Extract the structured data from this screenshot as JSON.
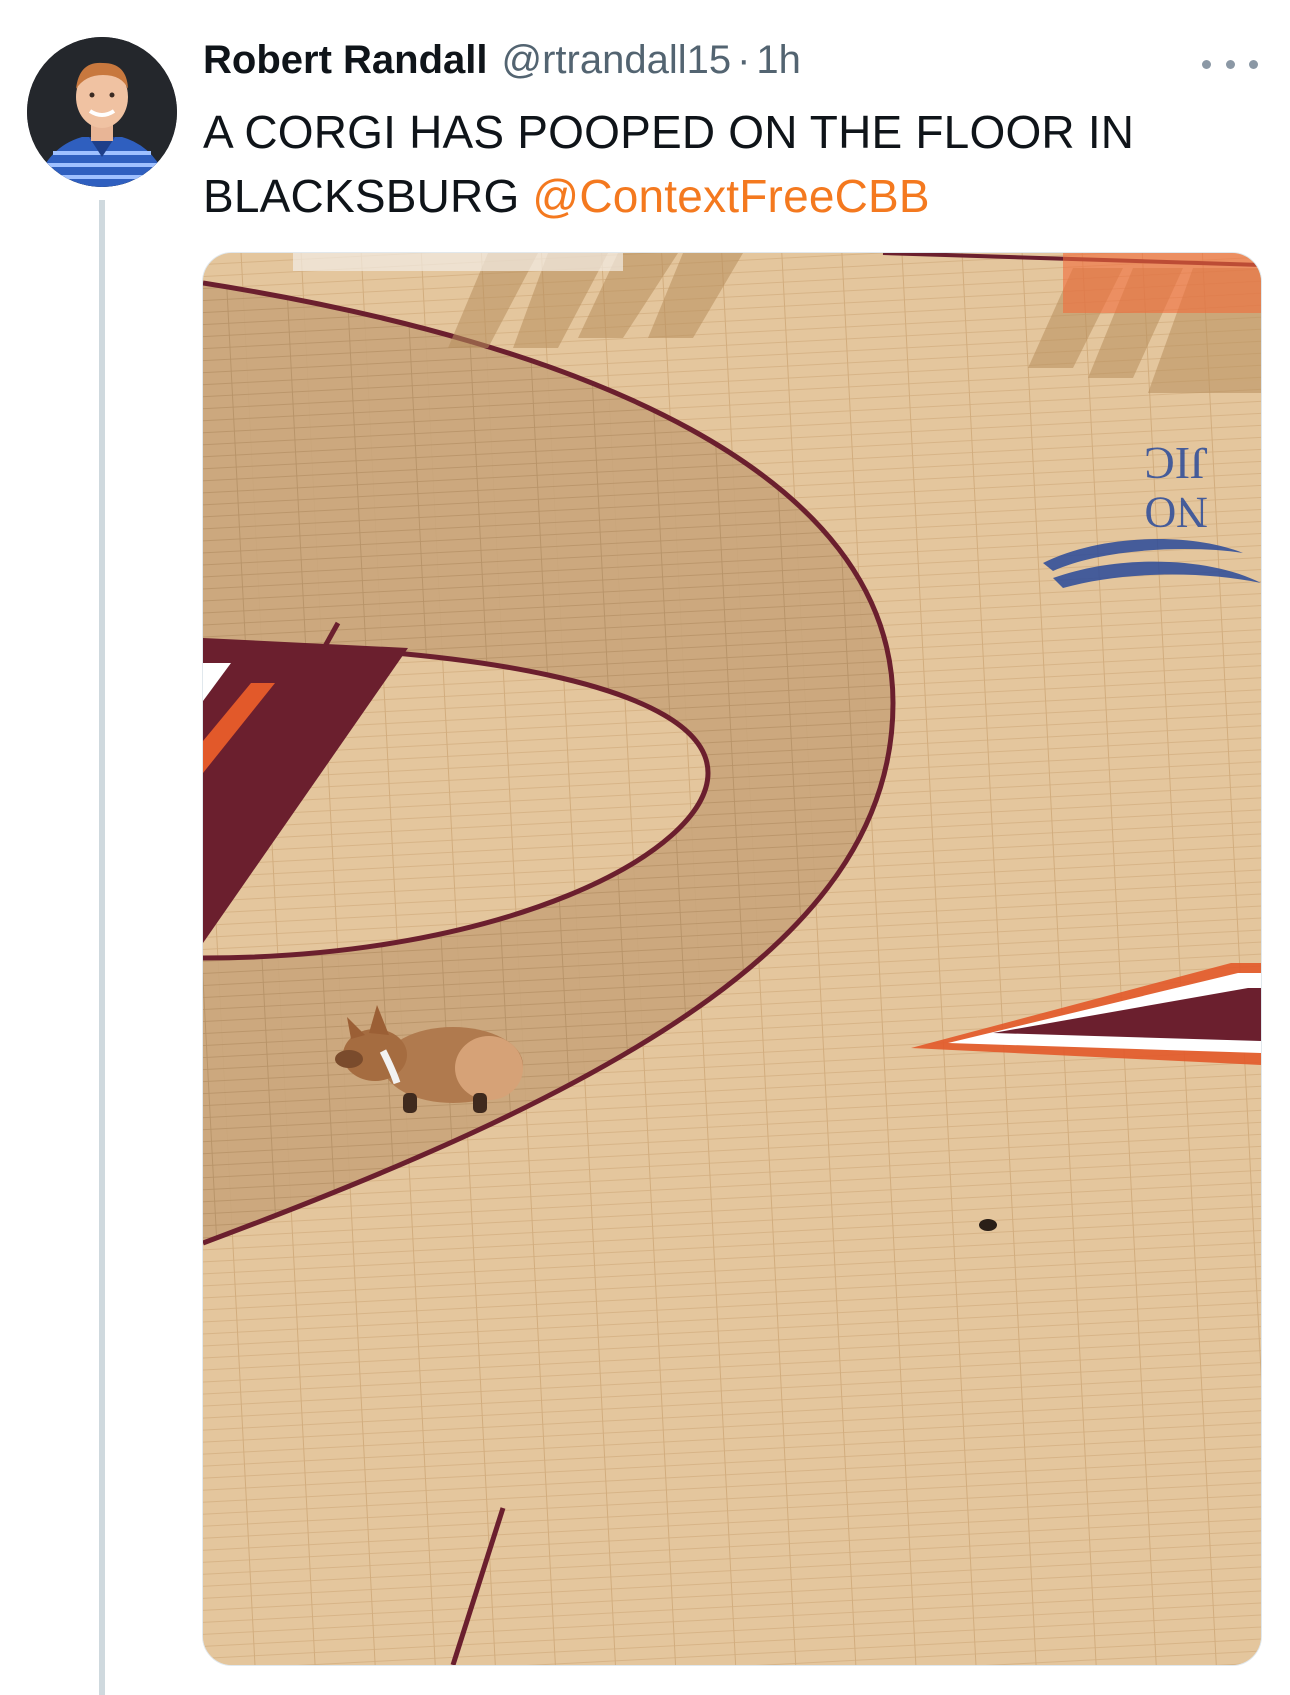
{
  "tweet": {
    "author_name": "Robert Randall",
    "handle": "@rtrandall15",
    "separator": "·",
    "time": "1h",
    "text_line1": "A CORGI HAS POOPED ON THE FLOOR IN",
    "text_line2": "BLACKSBURG",
    "mention": "@ContextFreeCBB",
    "more_icon": "more-horizontal-icon",
    "avatar_icon": "user-avatar",
    "media_alt": "A corgi on a basketball court floor with droppings nearby"
  },
  "court_logo": {
    "letters_top": "JIC",
    "letters_bottom": "NO"
  },
  "colors": {
    "text_primary": "#0f1419",
    "text_secondary": "#536471",
    "mention": "#f4791f",
    "thread_line": "#cfd9de",
    "maroon": "#6b1f2e",
    "orange": "#e2592a",
    "court_wood": "#e3c49a"
  }
}
